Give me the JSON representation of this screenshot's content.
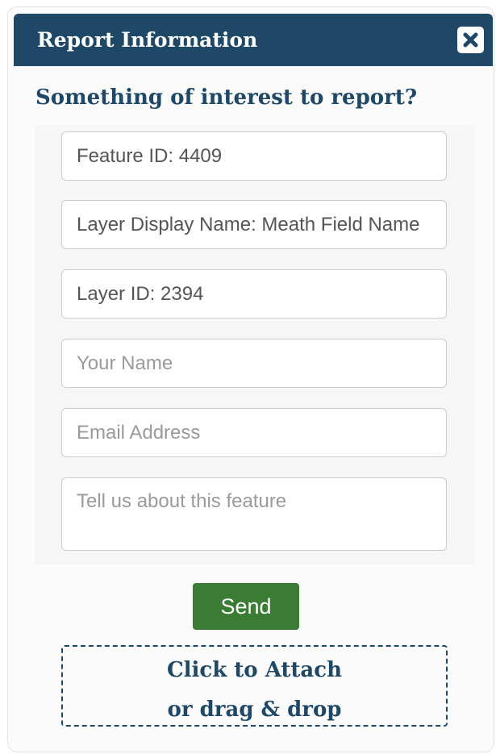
{
  "dialog": {
    "title": "Report Information",
    "close_icon": "close-icon",
    "close_label": "×"
  },
  "subtitle": "Something of interest to report?",
  "fields": {
    "feature_id": {
      "value": "Feature ID: 4409"
    },
    "layer_display_name": {
      "value": "Layer Display Name: Meath Field Name"
    },
    "layer_id": {
      "value": "Layer ID: 2394"
    },
    "your_name": {
      "value": "",
      "placeholder": "Your Name"
    },
    "email": {
      "value": "",
      "placeholder": "Email Address"
    },
    "message": {
      "value": "",
      "placeholder": "Tell us about this feature"
    }
  },
  "send_button": {
    "label": "Send"
  },
  "attach": {
    "line1": "Click to Attach",
    "line2": "or drag & drop"
  },
  "colors": {
    "header_bg": "#1f4867",
    "accent_text": "#1f4867",
    "send_bg": "#3a7c34"
  }
}
